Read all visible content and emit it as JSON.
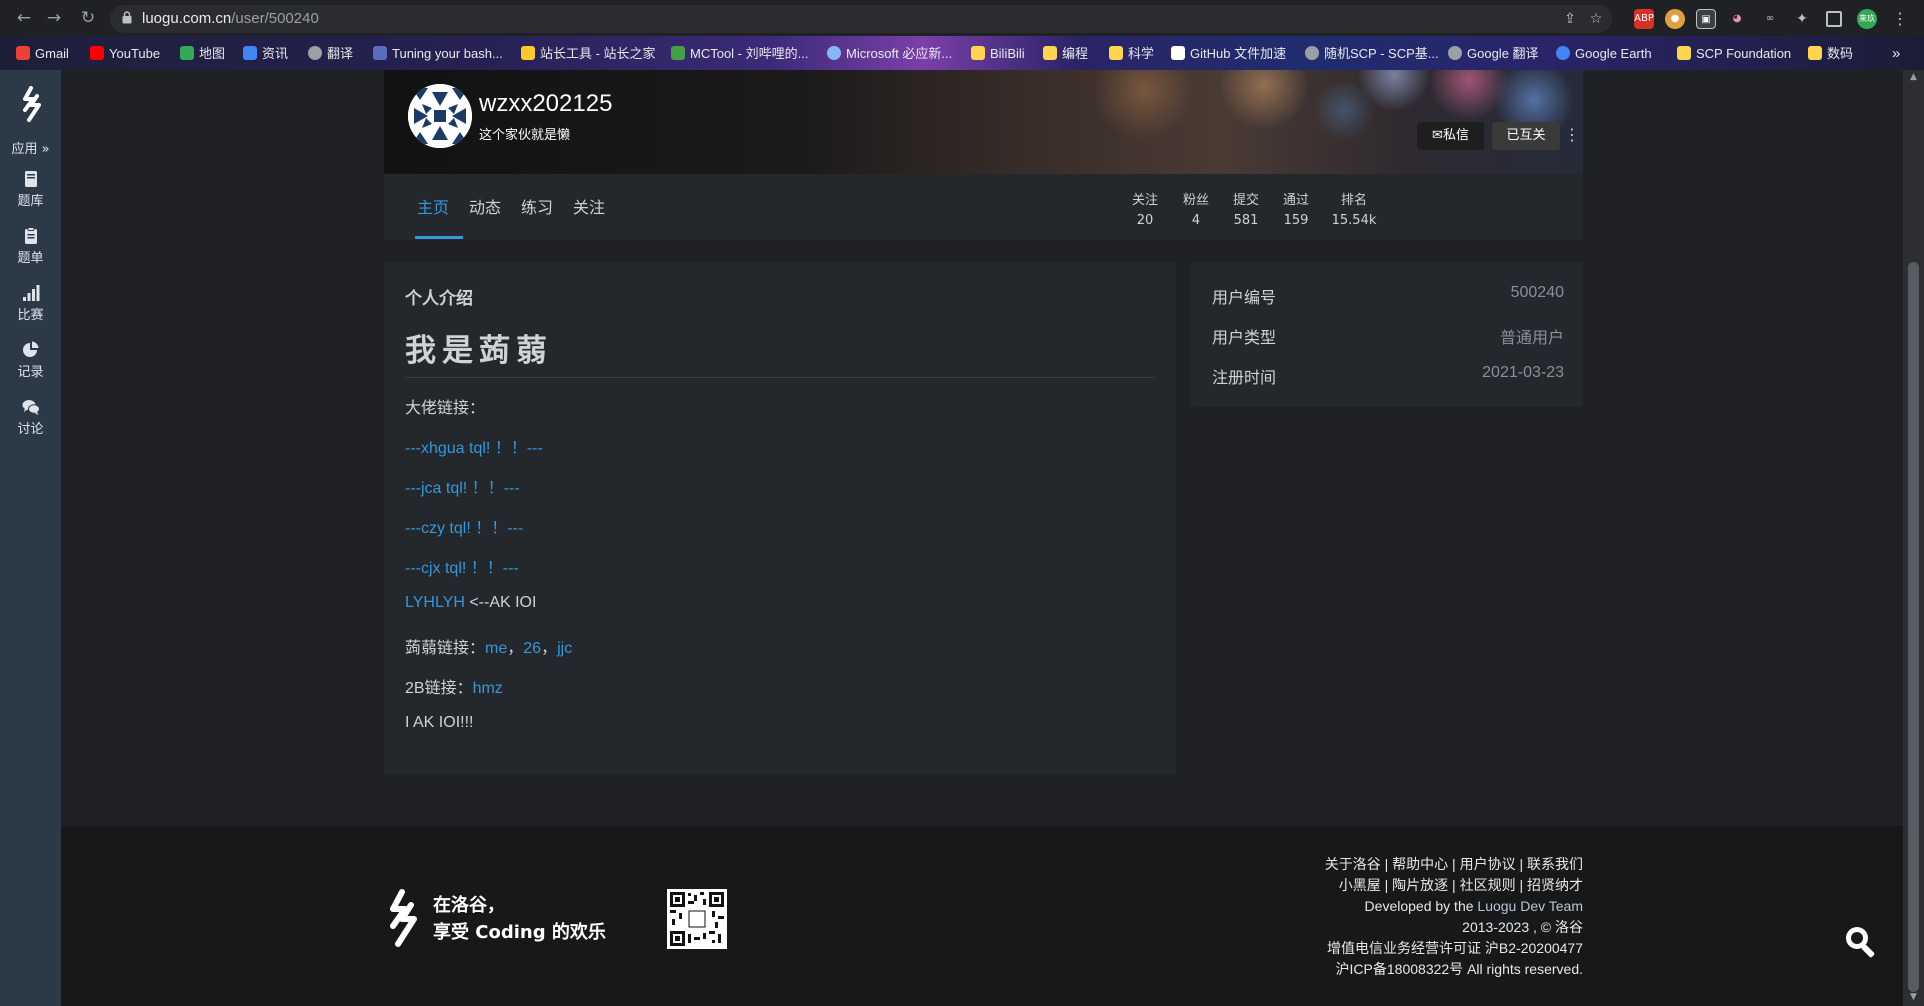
{
  "browser": {
    "url_host": "luogu.com.cn",
    "url_path": "/user/500240",
    "bookmarks": [
      {
        "label": "Gmail",
        "color": "#ea4335"
      },
      {
        "label": "YouTube",
        "color": "#ff0000"
      },
      {
        "label": "地图",
        "color": "#34a853"
      },
      {
        "label": "资讯",
        "color": "#4285f4"
      },
      {
        "label": "翻译",
        "color": "#9aa0a6"
      },
      {
        "label": "Tuning your bash...",
        "color": "#5c6bc0"
      },
      {
        "label": "站长工具 - 站长之家",
        "color": "#ffca28"
      },
      {
        "label": "MCTool - 刘哔哩的...",
        "color": "#43a047"
      },
      {
        "label": "Microsoft 必应新...",
        "color": "#8ab4f8"
      },
      {
        "label": "BiliBili",
        "color": "#ffd54f"
      },
      {
        "label": "编程",
        "color": "#ffd54f"
      },
      {
        "label": "科学",
        "color": "#ffd54f"
      },
      {
        "label": "GitHub 文件加速",
        "color": "#ffffff"
      },
      {
        "label": "随机SCP - SCP基...",
        "color": "#9aa0a6"
      },
      {
        "label": "Google 翻译",
        "color": "#9aa0a6"
      },
      {
        "label": "Google Earth",
        "color": "#4285f4"
      },
      {
        "label": "SCP Foundation",
        "color": "#ffd54f"
      },
      {
        "label": "数码",
        "color": "#ffd54f"
      }
    ],
    "more": "»"
  },
  "rail": {
    "app_label": "应用",
    "items": [
      {
        "label": "题库",
        "icon": "book-icon"
      },
      {
        "label": "题单",
        "icon": "clipboard-icon"
      },
      {
        "label": "比赛",
        "icon": "bar-chart-icon"
      },
      {
        "label": "记录",
        "icon": "pie-chart-icon"
      },
      {
        "label": "讨论",
        "icon": "comments-icon"
      }
    ]
  },
  "profile": {
    "username": "wzxx202125",
    "bio": "这个家伙就是懒",
    "message_button": "私信",
    "follow_button": "已互关",
    "tabs": [
      "主页",
      "动态",
      "练习",
      "关注"
    ],
    "active_tab": "主页",
    "stats": [
      {
        "label": "关注",
        "value": "20"
      },
      {
        "label": "粉丝",
        "value": "4"
      },
      {
        "label": "提交",
        "value": "581"
      },
      {
        "label": "通过",
        "value": "159"
      },
      {
        "label": "排名",
        "value": "15.54k"
      }
    ]
  },
  "intro": {
    "title": "个人介绍",
    "heading": "我是蒟蒻",
    "lines": {
      "l1": "大佬链接：",
      "l2": "---xhgua tql! ！！---",
      "l3": "---jca tql! ！！---",
      "l4": "---czy tql! ！！---",
      "l5": "---cjx tql! ！！---",
      "l6_link": "LYHLYH",
      "l6_text": " <--AK IOI",
      "l7_prefix": "蒟蒻链接：",
      "l7_links": [
        "me",
        "26",
        "jjc"
      ],
      "l7_sep": "，",
      "l8_prefix": "2B链接：",
      "l8_link": "hmz",
      "l9": "I AK IOI!!!"
    }
  },
  "info": {
    "rows": [
      {
        "key": "用户编号",
        "value": "500240"
      },
      {
        "key": "用户类型",
        "value": "普通用户"
      },
      {
        "key": "注册时间",
        "value": "2021-03-23"
      }
    ]
  },
  "footer": {
    "slogan_1": "在洛谷，",
    "slogan_2": "享受 Coding 的欢乐",
    "links_row1": [
      "关于洛谷",
      "帮助中心",
      "用户协议",
      "联系我们"
    ],
    "links_row2": [
      "小黑屋",
      "陶片放逐",
      "社区规则",
      "招贤纳才"
    ],
    "sep": " | ",
    "developed_prefix": "Developed by the ",
    "developed_team": "Luogu Dev Team",
    "copyright": "2013-2023 , © 洛谷",
    "license": "增值电信业务经营许可证 沪B2-20200477",
    "icp": "沪ICP备18008322号 All rights reserved."
  },
  "colors": {
    "accent": "#3498db",
    "rail_bg": "#2c3947",
    "card_bg": "#24272b"
  }
}
